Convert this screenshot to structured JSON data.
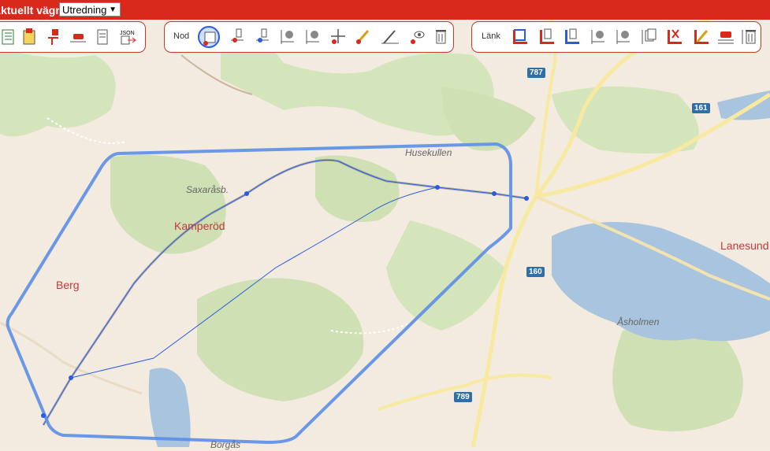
{
  "topbar": {
    "label": "Aktuellt vägnät:",
    "selected": "Utredning"
  },
  "nod_toolbar": {
    "label": "Nod"
  },
  "lank_toolbar": {
    "label": "Länk"
  },
  "map": {
    "places": [
      "Saxaråsb.",
      "Husekullen",
      "Åsholmen",
      "Borgås"
    ],
    "towns": [
      "Kamperöd",
      "Berg",
      "Lanesund"
    ],
    "roads": [
      "787",
      "161",
      "160",
      "789"
    ]
  },
  "colors": {
    "topbar": "#d9281c",
    "toolbar_border": "#c0392b",
    "polygon": "#5b8ee8",
    "route": "#2a5be0",
    "water": "#a9c4de",
    "forest": "#cfe0b4"
  }
}
